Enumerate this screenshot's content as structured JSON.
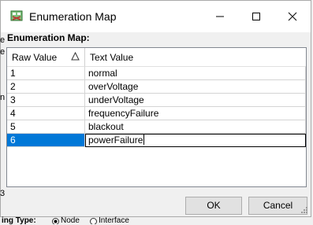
{
  "window": {
    "title": "Enumeration Map",
    "minimize": "—",
    "maximize": "☐",
    "close": "✕"
  },
  "map_label": "Enumeration Map:",
  "grid": {
    "col_raw": "Raw Value",
    "col_text": "Text Value",
    "rows": [
      {
        "raw": "1",
        "text": "normal"
      },
      {
        "raw": "2",
        "text": "overVoltage"
      },
      {
        "raw": "3",
        "text": "underVoltage"
      },
      {
        "raw": "4",
        "text": "frequencyFailure"
      },
      {
        "raw": "5",
        "text": "blackout"
      },
      {
        "raw": "6",
        "text": "powerFailure"
      }
    ],
    "selected_row": 6
  },
  "buttons": {
    "ok": "OK",
    "cancel": "Cancel"
  },
  "background": {
    "frag1": "e",
    "frag2": "e",
    "frag3": "n",
    "frag4": "3",
    "bottom_label": "ing Type:",
    "radio_node": "Node",
    "radio_interface": "Interface"
  },
  "colors": {
    "selection": "#0078d7",
    "dialog_bg": "#f0f0f0"
  }
}
